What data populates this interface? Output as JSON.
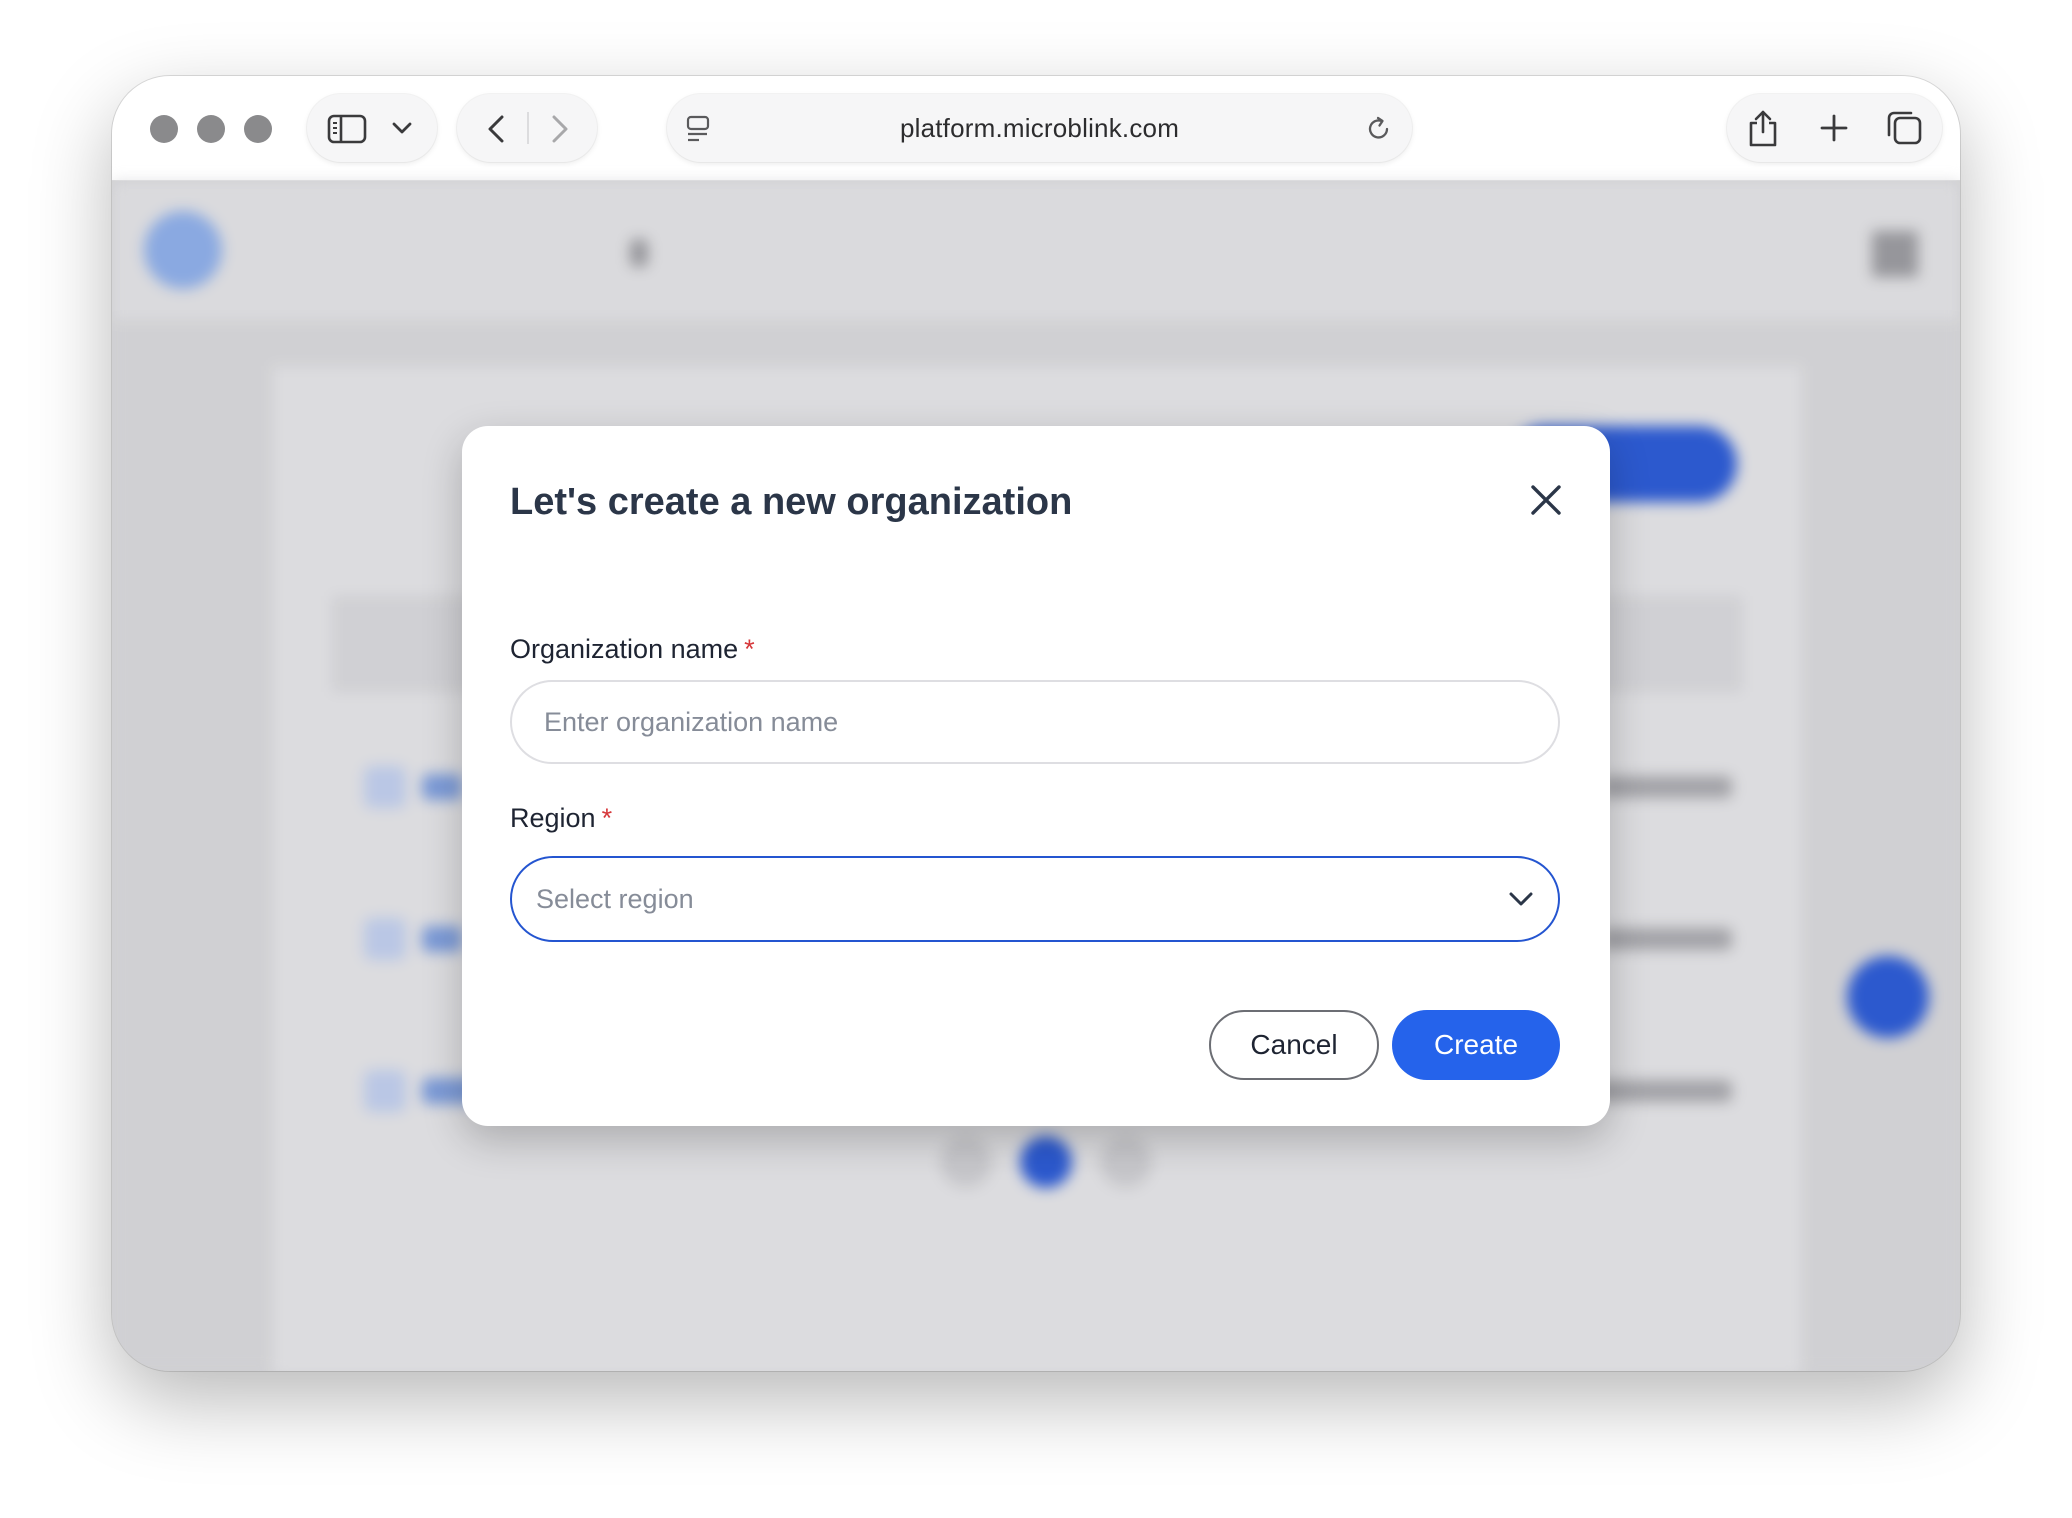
{
  "browser": {
    "url": "platform.microblink.com",
    "icons": {
      "close": "traffic-light-close",
      "minimize": "traffic-light-minimize",
      "zoom": "traffic-light-zoom",
      "sidebar": "sidebar-toggle-icon",
      "tab_menu": "chevron-down-icon",
      "back": "back-arrow-icon",
      "forward": "forward-arrow-icon",
      "page_menu": "page-settings-icon",
      "reload": "reload-icon",
      "share": "share-icon",
      "new_tab": "plus-icon",
      "tabs": "tab-overview-icon"
    }
  },
  "modal": {
    "title": "Let's create a new organization",
    "name_field": {
      "label": "Organization name",
      "required_mark": "*",
      "placeholder": "Enter organization name",
      "value": ""
    },
    "region_field": {
      "label": "Region",
      "required_mark": "*",
      "placeholder": "Select region"
    },
    "cancel_label": "Cancel",
    "create_label": "Create"
  },
  "colors": {
    "primary": "#2563eb",
    "required": "#d6373a",
    "title": "#2b3648",
    "focus_border": "#2455d0"
  }
}
